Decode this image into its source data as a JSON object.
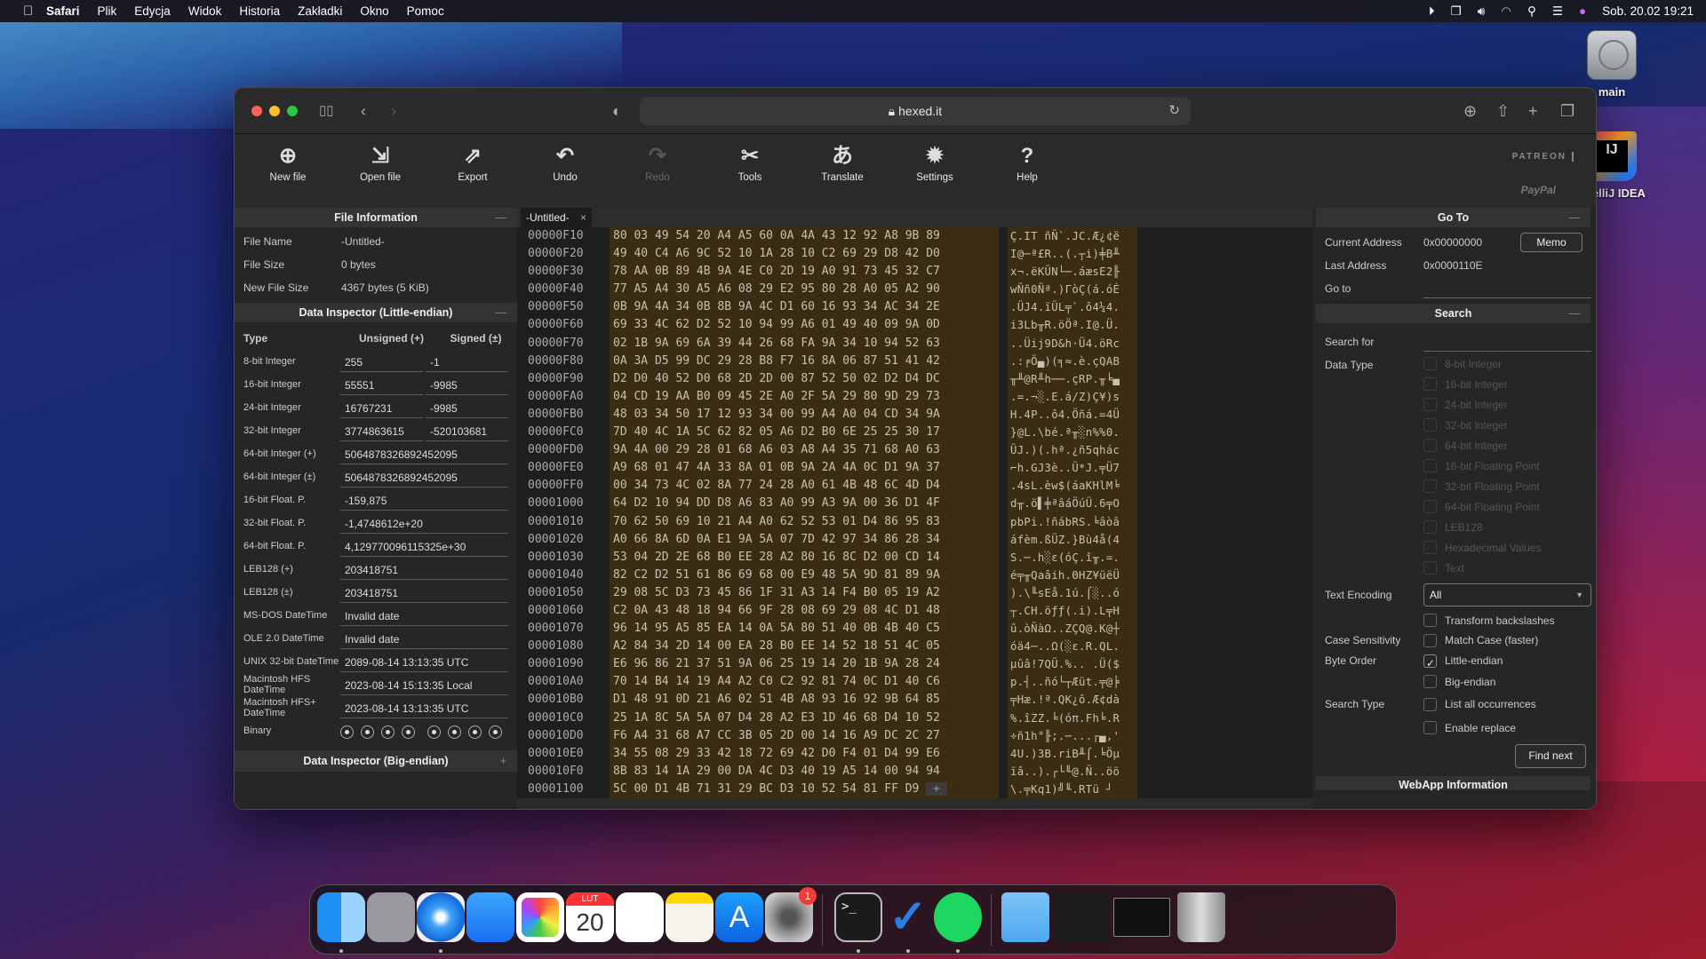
{
  "menubar": {
    "app": "Safari",
    "items": [
      "Plik",
      "Edycja",
      "Widok",
      "Historia",
      "Zakładki",
      "Okno",
      "Pomoc"
    ],
    "clock": "Sob. 20.02  19:21"
  },
  "desktop": {
    "icons": [
      {
        "label": "main"
      },
      {
        "label": "IntelliJ IDEA"
      }
    ]
  },
  "browser": {
    "url": "hexed.it"
  },
  "toolbar": {
    "buttons": [
      {
        "label": "New file",
        "icon": "new-file-icon",
        "glyph": "⊕"
      },
      {
        "label": "Open file",
        "icon": "open-file-icon",
        "glyph": "⇲"
      },
      {
        "label": "Export",
        "icon": "export-icon",
        "glyph": "⇗"
      },
      {
        "label": "Undo",
        "icon": "undo-icon",
        "glyph": "↶"
      },
      {
        "label": "Redo",
        "icon": "redo-icon",
        "glyph": "↷",
        "disabled": true
      },
      {
        "label": "Tools",
        "icon": "tools-icon",
        "glyph": "✂"
      },
      {
        "label": "Translate",
        "icon": "translate-icon",
        "glyph": "あ"
      },
      {
        "label": "Settings",
        "icon": "gear-icon",
        "glyph": "✹"
      },
      {
        "label": "Help",
        "icon": "help-icon",
        "glyph": "?"
      }
    ],
    "patreon": "PATREON",
    "paypal": "PayPal"
  },
  "file_info": {
    "title": "File Information",
    "rows": [
      {
        "key": "File Name",
        "value": "-Untitled-"
      },
      {
        "key": "File Size",
        "value": "0 bytes"
      },
      {
        "key": "New File Size",
        "value": "4367 bytes (5 KiB)"
      }
    ]
  },
  "data_inspector_le": {
    "title": "Data Inspector (Little-endian)",
    "headers": {
      "type": "Type",
      "unsigned": "Unsigned (+)",
      "signed": "Signed (±)"
    },
    "int_rows": [
      {
        "type": "8-bit Integer",
        "unsigned": "255",
        "signed": "-1"
      },
      {
        "type": "16-bit Integer",
        "unsigned": "55551",
        "signed": "-9985"
      },
      {
        "type": "24-bit Integer",
        "unsigned": "16767231",
        "signed": "-9985"
      },
      {
        "type": "32-bit Integer",
        "unsigned": "3774863615",
        "signed": "-520103681"
      }
    ],
    "wide_rows": [
      {
        "type": "64-bit Integer (+)",
        "value": "5064878326892452095"
      },
      {
        "type": "64-bit Integer (±)",
        "value": "5064878326892452095"
      },
      {
        "type": "16-bit Float. P.",
        "value": "-159,875"
      },
      {
        "type": "32-bit Float. P.",
        "value": "-1,4748612e+20"
      },
      {
        "type": "64-bit Float. P.",
        "value": "4,129770096115325e+30"
      },
      {
        "type": "LEB128 (+)",
        "value": "203418751"
      },
      {
        "type": "LEB128 (±)",
        "value": "203418751"
      },
      {
        "type": "MS-DOS DateTime",
        "value": "Invalid date"
      },
      {
        "type": "OLE 2.0 DateTime",
        "value": "Invalid date"
      },
      {
        "type": "UNIX 32-bit DateTime",
        "value": "2089-08-14 13:13:35 UTC"
      },
      {
        "type": "Macintosh HFS DateTime",
        "value": "2023-08-14 15:13:35 Local"
      },
      {
        "type": "Macintosh HFS+ DateTime",
        "value": "2023-08-14 13:13:35 UTC"
      }
    ],
    "binary_label": "Binary",
    "binary_bits": [
      1,
      1,
      1,
      1,
      1,
      1,
      1,
      1
    ]
  },
  "data_inspector_be": {
    "title": "Data Inspector (Big-endian)"
  },
  "editor": {
    "tab": "-Untitled-",
    "offsets": [
      "00000F10",
      "00000F20",
      "00000F30",
      "00000F40",
      "00000F50",
      "00000F60",
      "00000F70",
      "00000F80",
      "00000F90",
      "00000FA0",
      "00000FB0",
      "00000FC0",
      "00000FD0",
      "00000FE0",
      "00000FF0",
      "00001000",
      "00001010",
      "00001020",
      "00001030",
      "00001040",
      "00001050",
      "00001060",
      "00001070",
      "00001080",
      "00001090",
      "000010A0",
      "000010B0",
      "000010C0",
      "000010D0",
      "000010E0",
      "000010F0",
      "00001100"
    ],
    "hex_rows": [
      "80 03 49 54 20 A4 A5 60 0A 4A 43 12 92 A8 9B 89",
      "49 40 C4 A6 9C 52 10 1A 28 10 C2 69 29 D8 42 D0",
      "78 AA 0B 89 4B 9A 4E C0 2D 19 A0 91 73 45 32 C7",
      "77 A5 A4 30 A5 A6 08 29 E2 95 80 28 A0 05 A2 90",
      "0B 9A 4A 34 0B 8B 9A 4C D1 60 16 93 34 AC 34 2E",
      "69 33 4C 62 D2 52 10 94 99 A6 01 49 40 09 9A 0D",
      "02 1B 9A 69 6A 39 44 26 68 FA 9A 34 10 94 52 63",
      "0A 3A D5 99 DC 29 28 B8 F7 16 8A 06 87 51 41 42",
      "D2 D0 40 52 D0 68 2D 2D 00 87 52 50 02 D2 D4 DC",
      "04 CD 19 AA B0 09 45 2E A0 2F 5A 29 80 9D 29 73",
      "48 03 34 50 17 12 93 34 00 99 A4 A0 04 CD 34 9A",
      "7D 40 4C 1A 5C 62 82 05 A6 D2 B0 6E 25 25 30 17",
      "9A 4A 00 29 28 01 68 A6 03 A8 A4 35 71 68 A0 63",
      "A9 68 01 47 4A 33 8A 01 0B 9A 2A 4A 0C D1 9A 37",
      "00 34 73 4C 02 8A 77 24 28 A0 61 4B 48 6C 4D D4",
      "64 D2 10 94 DD D8 A6 83 A0 99 A3 9A 00 36 D1 4F",
      "70 62 50 69 10 21 A4 A0 62 52 53 01 D4 86 95 83",
      "A0 66 8A 6D 0A E1 9A 5A 07 7D 42 97 34 86 28 34",
      "53 04 2D 2E 68 B0 EE 28 A2 80 16 8C D2 00 CD 14",
      "82 C2 D2 51 61 86 69 68 00 E9 48 5A 9D 81 89 9A",
      "29 08 5C D3 73 45 86 1F 31 A3 14 F4 B0 05 19 A2",
      "C2 0A 43 48 18 94 66 9F 28 08 69 29 08 4C D1 48",
      "96 14 95 A5 85 EA 14 0A 5A 80 51 40 0B 4B 40 C5",
      "A2 84 34 2D 14 00 EA 28 B0 EE 14 52 18 51 4C 05",
      "E6 96 86 21 37 51 9A 06 25 19 14 20 1B 9A 28 24",
      "70 14 B4 14 19 A4 A2 C0 C2 92 81 74 0C D1 40 C6",
      "D1 48 91 0D 21 A6 02 51 4B A8 93 16 92 9B 64 85",
      "25 1A 8C 5A 5A 07 D4 28 A2 E3 1D 46 68 D4 10 52",
      "F6 A4 31 68 A7 CC 3B 05 2D 00 14 16 A9 DC 2C 27",
      "34 55 08 29 33 42 18 72 69 42 D0 F4 01 D4 99 E6",
      "8B 83 14 1A 29 00 DA 4C D3 40 19 A5 14 00 94 94",
      "5C 00 D1 4B 71 31 29 BC D3 10 52 54 81 FF D9"
    ],
    "cursor_cell": "+",
    "ascii_rows": [
      "Ç.IT ñÑ`.JC.Æ¿¢ë",
      "I@─ª£R..(.┬i)╪B╨",
      "x¬.ëKÜN└─.áæsE2╟",
      "wÑñ0Ñª.)ΓòÇ(á.óÉ",
      ".ÜJ4.ïÜL╤`.ô4¼4.",
      "i3Lb╥R.öÖª.I@.Ü.",
      "..Üij9D&h·Ü4.öRc",
      ".:╒Ö▄)(╕≈.è.çQAB",
      "╥╨@R╨h──.çRP.╥╘▄",
      ".=.¬░.E.á/Z)Ç¥)s",
      "H.4P..ô4.Öñá.=4Ü",
      "}@L.\\bé.ª╥░n%%0.",
      "ÜJ.)(.hª.¿ñ5qhác",
      "⌐h.GJ3è..Ü*J.╤Ü7",
      ".4sL.èw$(áaKHlM╘",
      "d╥.ö▌╪ªâáÖúÜ.6╤O",
      "pbPi.!ñábRS.╘âòâ",
      "áfèm.ßÜZ.}Bù4å(4",
      "S.─.h░ε(óÇ.î╥.=.",
      "é╤╥Qaâih.ΘHZ¥üëÜ",
      ").\\╙sEå.1ú.⌠░..ó",
      "┬.CH.öƒƒ(.i).L╤H",
      "û.òÑàΩ..ZÇQ@.K@┼",
      "óä4─..Ω(░ε.R.QL.",
      "µûâ!7QÜ.%.. .Ü($",
      "p.┤..ñó└┬Æüt.╤@╞",
      "╤Hæ.!ª.QK¿ô.Æ¢dà",
      "%.îZZ.╘(óπ.Fh╘.R",
      "÷ñ1h°╟;.─...┌▄,'",
      "4U.)3B.riB╨⌠.╘Öµ",
      "ïâ..).┌└╙@.Ñ..öö",
      "\\.╤Kq1)╝╙.RTü ┘"
    ]
  },
  "goto": {
    "title": "Go To",
    "current_address_label": "Current Address",
    "current_address": "0x00000000",
    "memo_label": "Memo",
    "last_address_label": "Last Address",
    "last_address": "0x0000110E",
    "goto_label": "Go to",
    "goto_value": ""
  },
  "search": {
    "title": "Search",
    "search_for_label": "Search for",
    "search_for_value": "",
    "data_type_label": "Data Type",
    "data_types": [
      {
        "label": "8-bit Integer",
        "checked": false
      },
      {
        "label": "16-bit Integer",
        "checked": false
      },
      {
        "label": "24-bit Integer",
        "checked": false
      },
      {
        "label": "32-bit Integer",
        "checked": false
      },
      {
        "label": "64-bit Integer",
        "checked": false
      },
      {
        "label": "16-bit Floating Point",
        "checked": false
      },
      {
        "label": "32-bit Floating Point",
        "checked": false
      },
      {
        "label": "64-bit Floating Point",
        "checked": false
      },
      {
        "label": "LEB128",
        "checked": false
      },
      {
        "label": "Hexadecimal Values",
        "checked": false
      },
      {
        "label": "Text",
        "checked": false
      }
    ],
    "text_encoding_label": "Text Encoding",
    "text_encoding_value": "All",
    "transform_backslashes": {
      "label": "Transform backslashes",
      "checked": false
    },
    "case_sensitivity_label": "Case Sensitivity",
    "match_case": {
      "label": "Match Case (faster)",
      "checked": false
    },
    "byte_order_label": "Byte Order",
    "little_endian": {
      "label": "Little-endian",
      "checked": true
    },
    "big_endian": {
      "label": "Big-endian",
      "checked": false
    },
    "search_type_label": "Search Type",
    "list_all": {
      "label": "List all occurrences",
      "checked": false
    },
    "enable_replace": {
      "label": "Enable replace",
      "checked": false
    },
    "find_next_label": "Find next"
  },
  "webapp_info": {
    "title": "WebApp Information"
  },
  "dock": {
    "apps": [
      "Finder",
      "Launchpad",
      "Safari",
      "Mail",
      "Photos",
      "Calendar",
      "Reminders",
      "Notes",
      "App Store",
      "System Preferences",
      "Terminal",
      "To Do",
      "Spotify",
      "Downloads",
      "Window preview 1",
      "Window preview 2",
      "Trash"
    ],
    "calendar_month": "LUT",
    "calendar_day": "20",
    "system_prefs_badge": "1"
  }
}
